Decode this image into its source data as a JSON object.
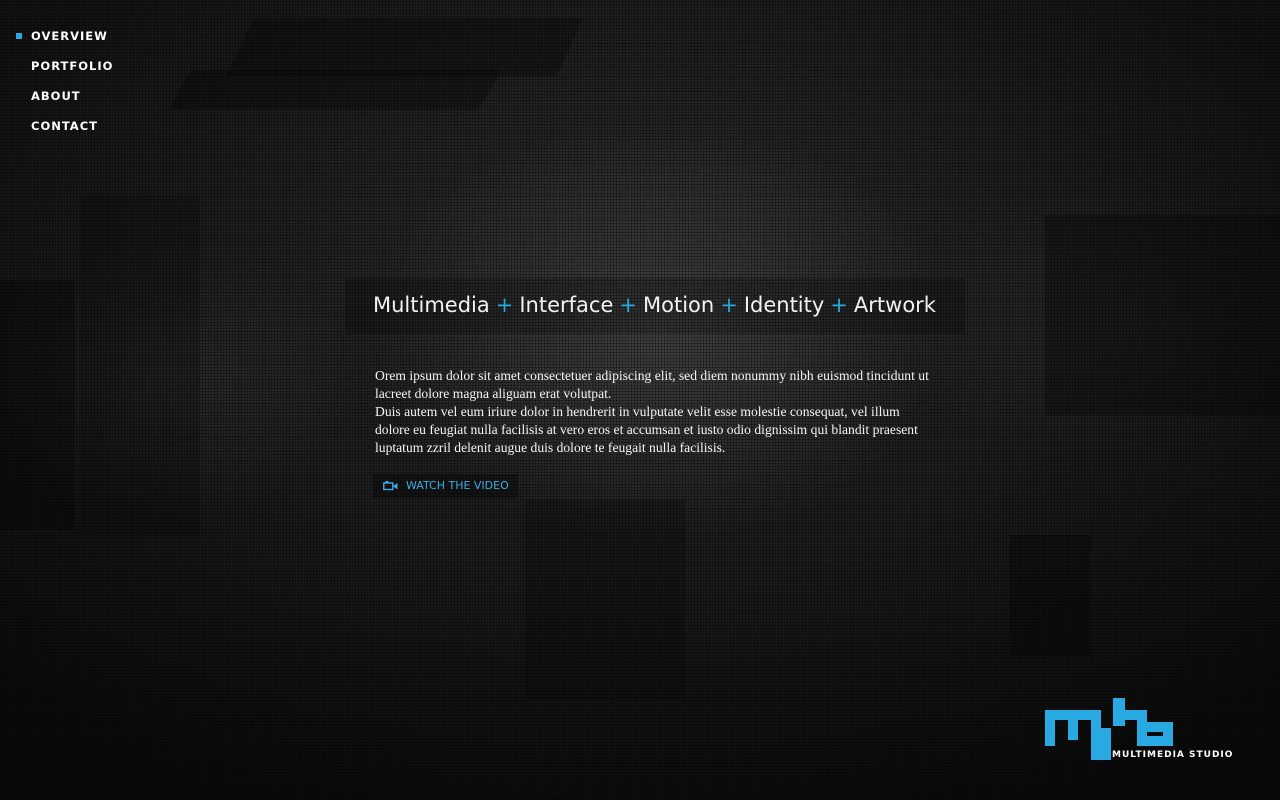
{
  "nav": {
    "items": [
      {
        "label": "OVERVIEW",
        "active": true
      },
      {
        "label": "PORTFOLIO",
        "active": false
      },
      {
        "label": "ABOUT",
        "active": false
      },
      {
        "label": "CONTACT",
        "active": false
      }
    ]
  },
  "tagline": {
    "words": [
      "Multimedia",
      "Interface",
      "Motion",
      "Identity",
      "Artwork"
    ],
    "separator": "+"
  },
  "intro": {
    "paragraph_1": "Orem ipsum dolor sit amet consectetuer adipiscing elit, sed diem nonummy nibh euismod tincidunt ut lacreet dolore magna aliguam erat volutpat.",
    "paragraph_2": "Duis autem vel eum iriure dolor in hendrerit in vulputate velit esse molestie consequat, vel illum dolore eu feugiat nulla facilisis at vero eros et accumsan et iusto odio dignissim qui blandit praesent luptatum zzril delenit augue duis dolore te feugait nulla facilisis."
  },
  "watch_button": {
    "icon": "video-camera-icon",
    "label": "WATCH THE VIDEO"
  },
  "logo": {
    "text": "MULTIMEDIA STUDIO"
  },
  "colors": {
    "accent": "#29a9e1",
    "text": "#ffffff",
    "background": "#1f1f1f"
  }
}
